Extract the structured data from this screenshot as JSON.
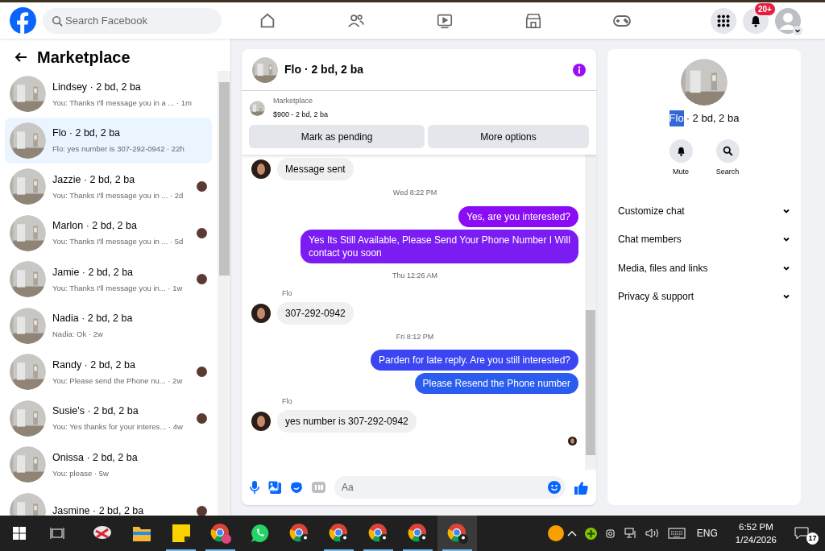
{
  "topbar": {
    "search_placeholder": "Search Facebook",
    "notification_badge": "20+"
  },
  "sidebar": {
    "title": "Marketplace",
    "conversations": [
      {
        "name": "Lindsey · 2 bd, 2 ba",
        "preview": "You: Thanks I'll message you in a ... · 1m",
        "selected": false,
        "seen": false
      },
      {
        "name": "Flo · 2 bd, 2 ba",
        "preview": "Flo: yes number is 307-292-0942 · 22h",
        "selected": true,
        "seen": false
      },
      {
        "name": "Jazzie · 2 bd, 2 ba",
        "preview": "You: Thanks I'll message you in ... · 2d",
        "selected": false,
        "seen": true
      },
      {
        "name": "Marlon · 2 bd, 2 ba",
        "preview": "You: Thanks I'll message you in ... · 5d",
        "selected": false,
        "seen": true
      },
      {
        "name": "Jamie · 2 bd, 2 ba",
        "preview": "You: Thanks I'll message you in... · 1w",
        "selected": false,
        "seen": true
      },
      {
        "name": "Nadia · 2 bd, 2 ba",
        "preview": "Nadia: Ok · 2w",
        "selected": false,
        "seen": false
      },
      {
        "name": "Randy · 2 bd, 2 ba",
        "preview": "You: Please send the Phone nu... · 2w",
        "selected": false,
        "seen": true
      },
      {
        "name": "Susie's · 2 bd, 2 ba",
        "preview": "You: Yes thanks for your interes... · 4w",
        "selected": false,
        "seen": true
      },
      {
        "name": "Onissa · 2 bd, 2 ba",
        "preview": "You: please · 5w",
        "selected": false,
        "seen": false
      },
      {
        "name": "Jasmine · 2 bd, 2 ba",
        "seen": true,
        "selected": false
      }
    ]
  },
  "chat": {
    "title": "Flo · 2 bd, 2 ba",
    "listing_source": "Marketplace",
    "listing": "$900 - 2 bd, 2 ba",
    "actions": [
      "Mark as pending",
      "More options"
    ],
    "messages": [
      {
        "kind": "incoming",
        "text": "Message sent"
      },
      {
        "kind": "time",
        "text": "Wed 8:22 PM"
      },
      {
        "kind": "outgoing",
        "text": "Yes, are you interested?",
        "color": "#8a0cf5"
      },
      {
        "kind": "outgoing",
        "text": "Yes Its Still Available, Please Send Your Phone Number I Will contact you soon",
        "color": "#7b1cf2"
      },
      {
        "kind": "time",
        "text": "Thu 12:26 AM"
      },
      {
        "kind": "sender",
        "text": "Flo"
      },
      {
        "kind": "incoming",
        "text": "307-292-0942"
      },
      {
        "kind": "time",
        "text": "Fri 8:12 PM"
      },
      {
        "kind": "outgoing",
        "text": "Parden for late reply. Are you still interested?",
        "color": "#3b46f2"
      },
      {
        "kind": "outgoing",
        "text": "Please Resend the Phone number",
        "color": "#2a5cf0"
      },
      {
        "kind": "sender",
        "text": "Flo"
      },
      {
        "kind": "incoming",
        "text": "yes number is 307-292-0942"
      }
    ],
    "composer_placeholder": "Aa"
  },
  "details": {
    "name": "Flo",
    "name_selected": true,
    "name_rest": "· 2 bd, 2 ba",
    "actions": [
      "Mute",
      "Search"
    ],
    "sections": [
      {
        "label": "Customize chat",
        "expanded": false
      },
      {
        "label": "Chat members",
        "expanded": false
      },
      {
        "label": "Media, files and links",
        "expanded": false
      },
      {
        "label": "Privacy & support",
        "expanded": false
      }
    ]
  },
  "taskbar": {
    "apps": [
      {
        "kind": "snip",
        "running": false,
        "selected": false
      },
      {
        "kind": "files",
        "running": false,
        "selected": false
      },
      {
        "kind": "sticky",
        "running": true,
        "selected": false
      },
      {
        "kind": "chrome",
        "running": true,
        "selected": false
      },
      {
        "kind": "whatsapp",
        "running": false,
        "selected": false
      },
      {
        "kind": "chrome",
        "running": false,
        "selected": false
      },
      {
        "kind": "chrome",
        "running": true,
        "selected": false
      },
      {
        "kind": "chrome",
        "running": true,
        "selected": false
      },
      {
        "kind": "chrome",
        "running": true,
        "selected": false
      },
      {
        "kind": "chrome",
        "running": true,
        "selected": true
      }
    ],
    "language": "ENG",
    "time": "6:52 PM",
    "date": "1/24/2026",
    "notifications": "17"
  }
}
